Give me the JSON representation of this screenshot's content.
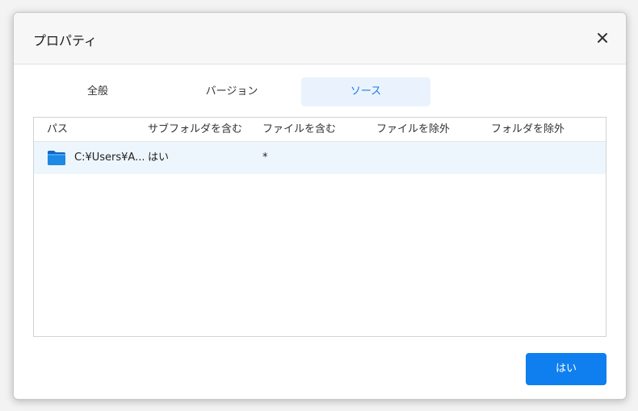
{
  "dialog": {
    "title": "プロパティ"
  },
  "tabs": [
    {
      "label": "全般",
      "active": false
    },
    {
      "label": "バージョン",
      "active": false
    },
    {
      "label": "ソース",
      "active": true
    }
  ],
  "table": {
    "columns": [
      "パス",
      "サブフォルダを含む",
      "ファイルを含む",
      "ファイルを除外",
      "フォルダを除外"
    ],
    "rows": [
      {
        "icon": "folder-icon",
        "path": "C:¥Users¥A...",
        "include_subfolders": "はい",
        "include_files": "*",
        "exclude_files": "",
        "exclude_folders": ""
      }
    ]
  },
  "footer": {
    "ok_label": "はい"
  },
  "colors": {
    "accent": "#0f7ff0",
    "active_tab_bg": "#eaf3fd",
    "active_tab_text": "#1d7ae6",
    "selected_row_bg": "#eef6fd",
    "folder": "#1e88e5"
  }
}
